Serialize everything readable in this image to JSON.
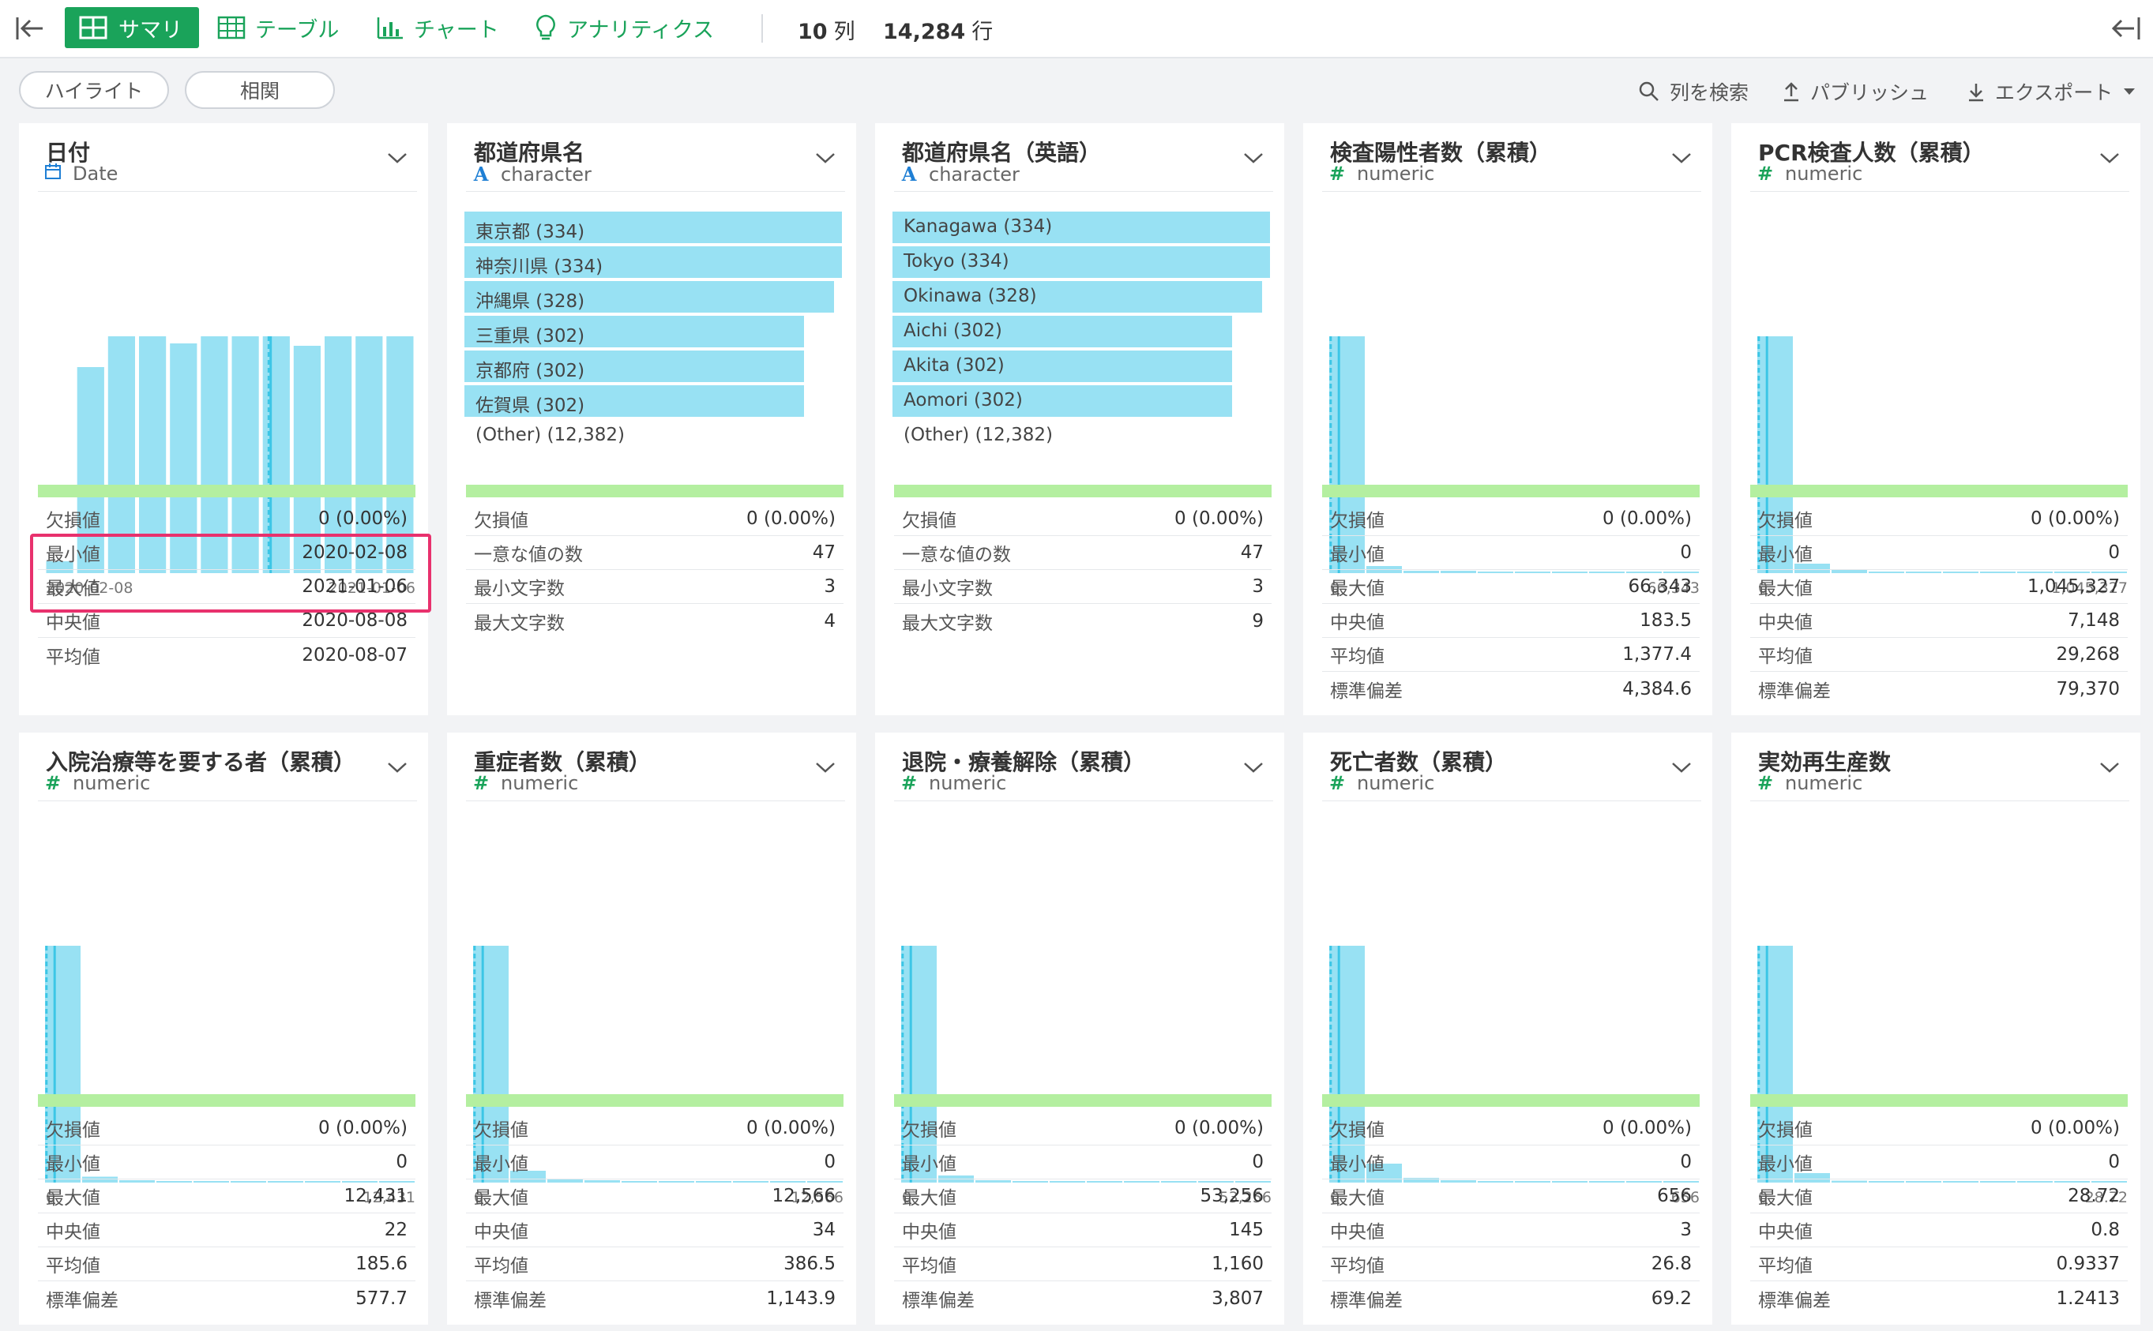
{
  "toolbar": {
    "tabs": [
      {
        "label": "サマリ",
        "icon": "grid-icon",
        "active": true
      },
      {
        "label": "テーブル",
        "icon": "table-icon"
      },
      {
        "label": "チャート",
        "icon": "bar-chart-icon"
      },
      {
        "label": "アナリティクス",
        "icon": "lightbulb-icon"
      }
    ],
    "columns_count": "10",
    "columns_unit": "列",
    "rows_count": "14,284",
    "rows_unit": "行",
    "accent": "#1aa35a"
  },
  "subbar": {
    "highlight_label": "ハイライト",
    "correlation_label": "相関",
    "search_label": "列を検索",
    "publish_label": "パブリッシュ",
    "export_label": "エクスポート"
  },
  "cards": [
    {
      "title": "日付",
      "type": "Date",
      "type_icon": "calendar-icon",
      "kind": "date",
      "axis_min": "2020-02-08",
      "axis_max": "2021-01-06",
      "hist": [
        0.05,
        0.87,
        1.0,
        1.0,
        0.97,
        1.0,
        1.0,
        1.0,
        0.96,
        1.0,
        1.0,
        1.0
      ],
      "stats": [
        {
          "label": "欠損値",
          "value": "0 (0.00%)"
        },
        {
          "label": "最小値",
          "value": "2020-02-08"
        },
        {
          "label": "最大値",
          "value": "2021-01-06"
        },
        {
          "label": "中央値",
          "value": "2020-08-08"
        },
        {
          "label": "平均値",
          "value": "2020-08-07"
        }
      ]
    },
    {
      "title": "都道府県名",
      "type": "character",
      "type_icon": "character-icon",
      "kind": "char",
      "categories": [
        {
          "label": "東京都 (334)",
          "share": 1.0
        },
        {
          "label": "神奈川県 (334)",
          "share": 1.0
        },
        {
          "label": "沖縄県 (328)",
          "share": 0.98
        },
        {
          "label": "三重県 (302)",
          "share": 0.9
        },
        {
          "label": "京都府 (302)",
          "share": 0.9
        },
        {
          "label": "佐賀県 (302)",
          "share": 0.9
        }
      ],
      "other": "(Other) (12,382)",
      "stats": [
        {
          "label": "欠損値",
          "value": "0 (0.00%)"
        },
        {
          "label": "一意な値の数",
          "value": "47"
        },
        {
          "label": "最小文字数",
          "value": "3"
        },
        {
          "label": "最大文字数",
          "value": "4"
        }
      ]
    },
    {
      "title": "都道府県名（英語）",
      "type": "character",
      "type_icon": "character-icon",
      "kind": "char",
      "categories": [
        {
          "label": "Kanagawa (334)",
          "share": 1.0
        },
        {
          "label": "Tokyo (334)",
          "share": 1.0
        },
        {
          "label": "Okinawa (328)",
          "share": 0.98
        },
        {
          "label": "Aichi (302)",
          "share": 0.9
        },
        {
          "label": "Akita (302)",
          "share": 0.9
        },
        {
          "label": "Aomori (302)",
          "share": 0.9
        }
      ],
      "other": "(Other) (12,382)",
      "stats": [
        {
          "label": "欠損値",
          "value": "0 (0.00%)"
        },
        {
          "label": "一意な値の数",
          "value": "47"
        },
        {
          "label": "最小文字数",
          "value": "3"
        },
        {
          "label": "最大文字数",
          "value": "9"
        }
      ]
    },
    {
      "title": "検査陽性者数（累積）",
      "type": "numeric",
      "type_icon": "hash-icon",
      "kind": "num",
      "axis_min": "0",
      "axis_max": "66,343",
      "hist": [
        1.0,
        0.03,
        0.01,
        0.01,
        0.005,
        0.005,
        0.005,
        0.005,
        0.004,
        0.004
      ],
      "stats": [
        {
          "label": "欠損値",
          "value": "0 (0.00%)"
        },
        {
          "label": "最小値",
          "value": "0"
        },
        {
          "label": "最大値",
          "value": "66,343"
        },
        {
          "label": "中央値",
          "value": "183.5"
        },
        {
          "label": "平均値",
          "value": "1,377.4"
        },
        {
          "label": "標準偏差",
          "value": "4,384.6"
        }
      ]
    },
    {
      "title": "PCR検査人数（累積）",
      "type": "numeric",
      "type_icon": "hash-icon",
      "kind": "num",
      "axis_min": "0",
      "axis_max": "1,045,327",
      "hist": [
        1.0,
        0.04,
        0.015,
        0.006,
        0.005,
        0.004,
        0.004,
        0.004,
        0.004,
        0.004
      ],
      "stats": [
        {
          "label": "欠損値",
          "value": "0 (0.00%)"
        },
        {
          "label": "最小値",
          "value": "0"
        },
        {
          "label": "最大値",
          "value": "1,045,327"
        },
        {
          "label": "中央値",
          "value": "7,148"
        },
        {
          "label": "平均値",
          "value": "29,268"
        },
        {
          "label": "標準偏差",
          "value": "79,370"
        }
      ]
    },
    {
      "title": "入院治療等を要する者（累積）",
      "type": "numeric",
      "type_icon": "hash-icon",
      "kind": "num",
      "axis_min": "0",
      "axis_max": "12,431",
      "hist": [
        1.0,
        0.025,
        0.01,
        0.006,
        0.005,
        0.005,
        0.004,
        0.004,
        0.004,
        0.004
      ],
      "stats": [
        {
          "label": "欠損値",
          "value": "0 (0.00%)"
        },
        {
          "label": "最小値",
          "value": "0"
        },
        {
          "label": "最大値",
          "value": "12,431"
        },
        {
          "label": "中央値",
          "value": "22"
        },
        {
          "label": "平均値",
          "value": "185.6"
        },
        {
          "label": "標準偏差",
          "value": "577.7"
        }
      ]
    },
    {
      "title": "重症者数（累積）",
      "type": "numeric",
      "type_icon": "hash-icon",
      "kind": "num",
      "axis_min": "0",
      "axis_max": "12,566",
      "hist": [
        1.0,
        0.05,
        0.015,
        0.01,
        0.006,
        0.005,
        0.005,
        0.004,
        0.004,
        0.004
      ],
      "stats": [
        {
          "label": "欠損値",
          "value": "0 (0.00%)"
        },
        {
          "label": "最小値",
          "value": "0"
        },
        {
          "label": "最大値",
          "value": "12,566"
        },
        {
          "label": "中央値",
          "value": "34"
        },
        {
          "label": "平均値",
          "value": "386.5"
        },
        {
          "label": "標準偏差",
          "value": "1,143.9"
        }
      ]
    },
    {
      "title": "退院・療養解除（累積）",
      "type": "numeric",
      "type_icon": "hash-icon",
      "kind": "num",
      "axis_min": "0",
      "axis_max": "53,256",
      "hist": [
        1.0,
        0.03,
        0.01,
        0.006,
        0.005,
        0.005,
        0.004,
        0.004,
        0.004,
        0.004
      ],
      "stats": [
        {
          "label": "欠損値",
          "value": "0 (0.00%)"
        },
        {
          "label": "最小値",
          "value": "0"
        },
        {
          "label": "最大値",
          "value": "53,256"
        },
        {
          "label": "中央値",
          "value": "145"
        },
        {
          "label": "平均値",
          "value": "1,160"
        },
        {
          "label": "標準偏差",
          "value": "3,807"
        }
      ]
    },
    {
      "title": "死亡者数（累積）",
      "type": "numeric",
      "type_icon": "hash-icon",
      "kind": "num",
      "axis_min": "0",
      "axis_max": "656",
      "hist": [
        1.0,
        0.08,
        0.02,
        0.01,
        0.006,
        0.005,
        0.005,
        0.004,
        0.004,
        0.004
      ],
      "stats": [
        {
          "label": "欠損値",
          "value": "0 (0.00%)"
        },
        {
          "label": "最小値",
          "value": "0"
        },
        {
          "label": "最大値",
          "value": "656"
        },
        {
          "label": "中央値",
          "value": "3"
        },
        {
          "label": "平均値",
          "value": "26.8"
        },
        {
          "label": "標準偏差",
          "value": "69.2"
        }
      ]
    },
    {
      "title": "実効再生産数",
      "type": "numeric",
      "type_icon": "hash-icon",
      "kind": "num",
      "axis_min": "0",
      "axis_max": "28.72",
      "hist": [
        1.0,
        0.04,
        0.008,
        0.005,
        0.004,
        0.004,
        0.004,
        0.004,
        0.004,
        0.004
      ],
      "stats": [
        {
          "label": "欠損値",
          "value": "0 (0.00%)"
        },
        {
          "label": "最小値",
          "value": "0"
        },
        {
          "label": "最大値",
          "value": "28.72"
        },
        {
          "label": "中央値",
          "value": "0.8"
        },
        {
          "label": "平均値",
          "value": "0.9337"
        },
        {
          "label": "標準偏差",
          "value": "1.2413"
        }
      ]
    }
  ],
  "colors": {
    "bar": "#98e1f3",
    "bar_line": "#3cc6e6",
    "quality": "#b4efa0",
    "highlight": "#e8316d"
  }
}
